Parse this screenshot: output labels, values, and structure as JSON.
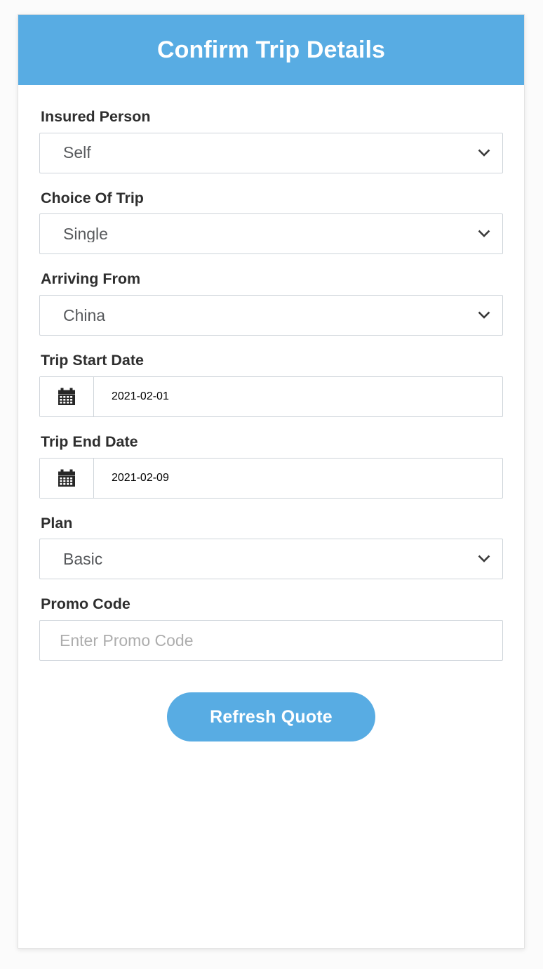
{
  "header": {
    "title": "Confirm Trip Details",
    "background_color": "#58ACE3",
    "text_color": "#ffffff"
  },
  "form": {
    "fields": [
      {
        "key": "insured_person",
        "label": "Insured Person",
        "type": "select",
        "value": "Self",
        "icon": "chevron-down-icon"
      },
      {
        "key": "choice_of_trip",
        "label": "Choice Of Trip",
        "type": "select",
        "value": "Single",
        "icon": "chevron-down-icon"
      },
      {
        "key": "arriving_from",
        "label": "Arriving From",
        "type": "select",
        "value": "China",
        "icon": "chevron-down-icon"
      },
      {
        "key": "trip_start_date",
        "label": "Trip Start Date",
        "type": "date",
        "value": "2021-02-01",
        "icon": "calendar-icon"
      },
      {
        "key": "trip_end_date",
        "label": "Trip End Date",
        "type": "date",
        "value": "2021-02-09",
        "icon": "calendar-icon"
      },
      {
        "key": "plan",
        "label": "Plan",
        "type": "select",
        "value": "Basic",
        "icon": "chevron-down-icon"
      },
      {
        "key": "promo_code",
        "label": "Promo Code",
        "type": "text",
        "value": "",
        "placeholder": "Enter Promo Code"
      }
    ]
  },
  "actions": {
    "refresh_quote_label": "Refresh Quote",
    "button_color": "#58ACE3"
  },
  "colors": {
    "page_background": "#fbfbfb",
    "card_background": "#ffffff",
    "accent": "#58ACE3",
    "border": "#ced4da",
    "label_text": "#2e2e2e",
    "value_text": "#57595c",
    "placeholder_text": "#adadad"
  }
}
